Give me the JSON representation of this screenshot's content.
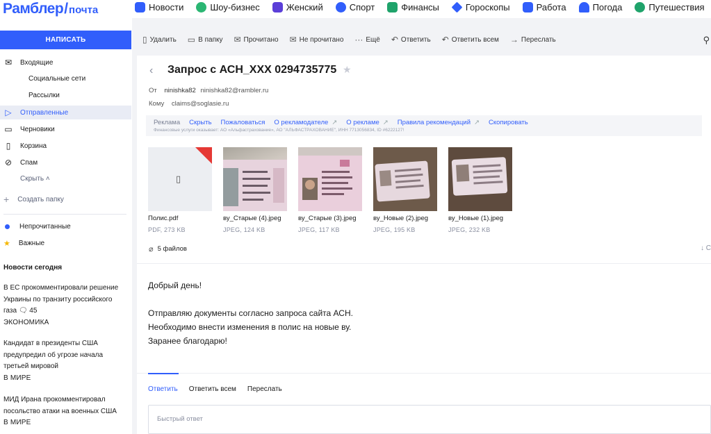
{
  "brand": {
    "name": "Рамблер",
    "slash": "/",
    "product": "почта"
  },
  "topnav": [
    {
      "label": "Новости",
      "color": "#315efb",
      "icon": "news-icon"
    },
    {
      "label": "Шоу-бизнес",
      "color": "#2bb673",
      "icon": "microphone-icon"
    },
    {
      "label": "Женский",
      "color": "#5b3fd8",
      "icon": "crown-icon"
    },
    {
      "label": "Спорт",
      "color": "#315efb",
      "icon": "ball-icon"
    },
    {
      "label": "Финансы",
      "color": "#1fa36b",
      "icon": "finance-icon"
    },
    {
      "label": "Гороскопы",
      "color": "#315efb",
      "icon": "star-icon"
    },
    {
      "label": "Работа",
      "color": "#315efb",
      "icon": "briefcase-icon"
    },
    {
      "label": "Погода",
      "color": "#315efb",
      "icon": "umbrella-icon"
    },
    {
      "label": "Путешествия",
      "color": "#1fa36b",
      "icon": "travel-icon"
    }
  ],
  "sidebar": {
    "compose": "НАПИСАТЬ",
    "inbox": "Входящие",
    "social": "Социальные сети",
    "mailings": "Рассылки",
    "sent": "Отправленные",
    "drafts": "Черновики",
    "trash": "Корзина",
    "spam": "Спам",
    "hide": "Скрыть",
    "create_folder": "Создать папку",
    "unread": "Непрочитанные",
    "important": "Важные",
    "news_title": "Новости сегодня",
    "news": [
      {
        "text": "В ЕС прокомментировали решение Украины по транзиту российского газа",
        "comments": "45",
        "category": "ЭКОНОМИКА"
      },
      {
        "text": "Кандидат в президенты США предупредил об угрозе начала третьей мировой",
        "category": "В МИРЕ"
      },
      {
        "text": "МИД Ирана прокомментировал посольство атаки на военных США",
        "category": "В МИРЕ"
      }
    ]
  },
  "toolbar": {
    "delete": "Удалить",
    "to_folder": "В папку",
    "read": "Прочитано",
    "unread": "Не прочитано",
    "more": "Ещё",
    "reply": "Ответить",
    "reply_all": "Ответить всем",
    "forward": "Переслать"
  },
  "letter": {
    "subject": "Запрос с АСН_XXX 0294735775",
    "from_label": "От",
    "from_name": "ninishka82",
    "from_email": "ninishka82@rambler.ru",
    "to_label": "Кому",
    "to_email": "claims@soglasie.ru",
    "ad": {
      "label": "Реклама",
      "hide": "Скрыть",
      "complain": "Пожаловаться",
      "advertiser": "О рекламодателе",
      "about": "О рекламе",
      "rules": "Правила рекомендаций",
      "copy": "Скопировать",
      "disclaimer": "Финансовые услуги оказывает: АО «Альфастрахование», АО \"АЛЬФАСТРАХОВАНИЕ\", ИНН 7713056834, ID #6222127!"
    },
    "attachments": [
      {
        "name": "Полис.pdf",
        "meta": "PDF, 273 KB",
        "type": "pdf"
      },
      {
        "name": "ву_Старые (4).jpeg",
        "meta": "JPEG, 124 KB",
        "type": "img"
      },
      {
        "name": "ву_Старые (3).jpeg",
        "meta": "JPEG, 117 KB",
        "type": "img"
      },
      {
        "name": "ву_Новые (2).jpeg",
        "meta": "JPEG, 195 KB",
        "type": "img"
      },
      {
        "name": "ву_Новые (1).jpeg",
        "meta": "JPEG, 232 KB",
        "type": "img"
      }
    ],
    "files_count": "5 файлов",
    "body": [
      "Добрый день!",
      "Отправляю документы согласно запроса сайта АСН.",
      "Необходимо внести изменения в полис на новые ву.",
      "Заранее благодарю!"
    ],
    "reply_tabs": {
      "reply": "Ответить",
      "reply_all": "Ответить всем",
      "forward": "Переслать"
    },
    "quick_reply": "Быстрый ответ"
  }
}
